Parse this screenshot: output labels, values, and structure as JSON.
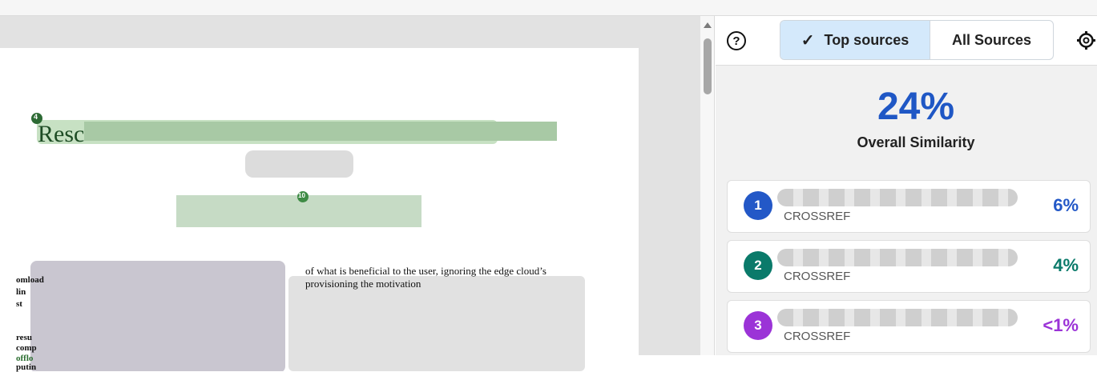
{
  "panel": {
    "tabs": [
      {
        "label": "Top sources",
        "selected": true
      },
      {
        "label": "All Sources",
        "selected": false
      }
    ],
    "overall": {
      "percent": "24%",
      "label": "Overall Similarity"
    },
    "sources": [
      {
        "number": "1",
        "type": "CROSSREF",
        "percent": "6%",
        "color": "#2358c7"
      },
      {
        "number": "2",
        "type": "CROSSREF",
        "percent": "4%",
        "color": "#0a7a6a"
      },
      {
        "number": "3",
        "type": "CROSSREF",
        "percent": "<1%",
        "color": "#9b33d7"
      }
    ]
  },
  "document": {
    "title_fragment": "Resc",
    "marker_4": "4",
    "marker_10": "10",
    "line1": "of what is beneficial to the user, ignoring the edge cloud’s",
    "line2": "provisioning the motivation",
    "left_fragments": [
      "omload",
      "lin",
      "st",
      "resu",
      "comp",
      "offlo",
      "putin"
    ]
  },
  "icons": {
    "help": "help-circle-icon",
    "check": "check-icon",
    "settings": "gear-icon"
  }
}
